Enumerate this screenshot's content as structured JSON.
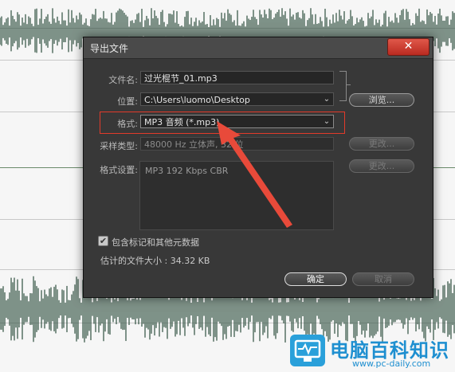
{
  "dialog": {
    "title": "导出文件",
    "close_glyph": "✕"
  },
  "form": {
    "filename_label": "文件名:",
    "filename_value": "过光棍节_01.mp3",
    "location_label": "位置:",
    "location_value": "C:\\Users\\luomo\\Desktop",
    "browse_label": "浏览...",
    "format_label": "格式:",
    "format_value": "MP3 音频 (*.mp3)",
    "sample_type_label": "采样类型:",
    "sample_type_value": "48000 Hz 立体声, 32 位",
    "format_settings_label": "格式设置:",
    "format_settings_value": "MP3 192 Kbps CBR",
    "change_label": "更改...",
    "include_markers_label": "包含标记和其他元数据",
    "include_markers_checked": true,
    "estimated_size_label": "估计的文件大小 : 34.32 KB",
    "ok_label": "确定",
    "cancel_label": "取消"
  },
  "watermark": {
    "title": "电脑百科知识",
    "url": "www.pc-daily.com"
  },
  "colors": {
    "waveform": "#2f4f3f",
    "dialog_bg": "#383838",
    "highlight_box": "#e23a2a",
    "arrow": "#e84a3a",
    "watermark": "#1e8fd0"
  },
  "icons": {
    "close": "close-icon",
    "dropdown": "chevron-down-icon",
    "checkbox": "checkmark-icon",
    "logo": "monitor-pulse-icon"
  }
}
